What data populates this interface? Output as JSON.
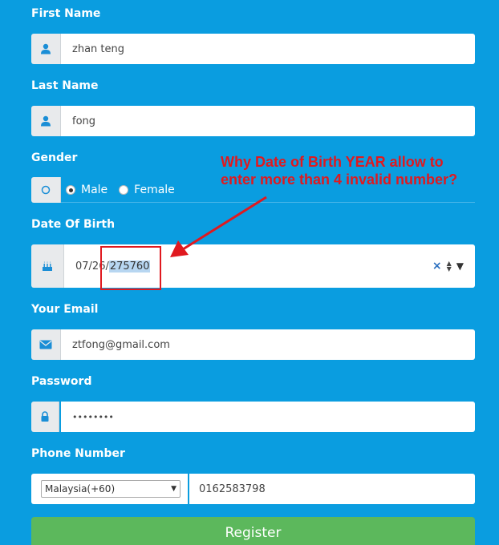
{
  "form": {
    "first_name": {
      "label": "First Name",
      "value": "zhan teng",
      "icon": "user-icon"
    },
    "last_name": {
      "label": "Last Name",
      "value": "fong",
      "icon": "user-icon"
    },
    "gender": {
      "label": "Gender",
      "icon": "circle-icon",
      "options": [
        {
          "label": "Male",
          "checked": true
        },
        {
          "label": "Female",
          "checked": false
        }
      ]
    },
    "dob": {
      "label": "Date Of Birth",
      "month_day": "07/26/",
      "year": "275760",
      "clear_symbol": "×",
      "icon": "birthday-cake-icon"
    },
    "email": {
      "label": "Your Email",
      "value": "ztfong@gmail.com",
      "icon": "envelope-icon"
    },
    "password": {
      "label": "Password",
      "value": "••••••••",
      "icon": "lock-icon"
    },
    "phone": {
      "label": "Phone Number",
      "country": "Malaysia(+60)",
      "value": "0162583798"
    },
    "register_label": "Register"
  },
  "annotation": {
    "text": "Why Date of Birth YEAR allow to\nenter more than 4 invalid number?",
    "color": "#e0191f"
  },
  "colors": {
    "background": "#0a9de0",
    "addon": "#e8eaec",
    "icon": "#1a8ed6",
    "register": "#5cb85c"
  }
}
